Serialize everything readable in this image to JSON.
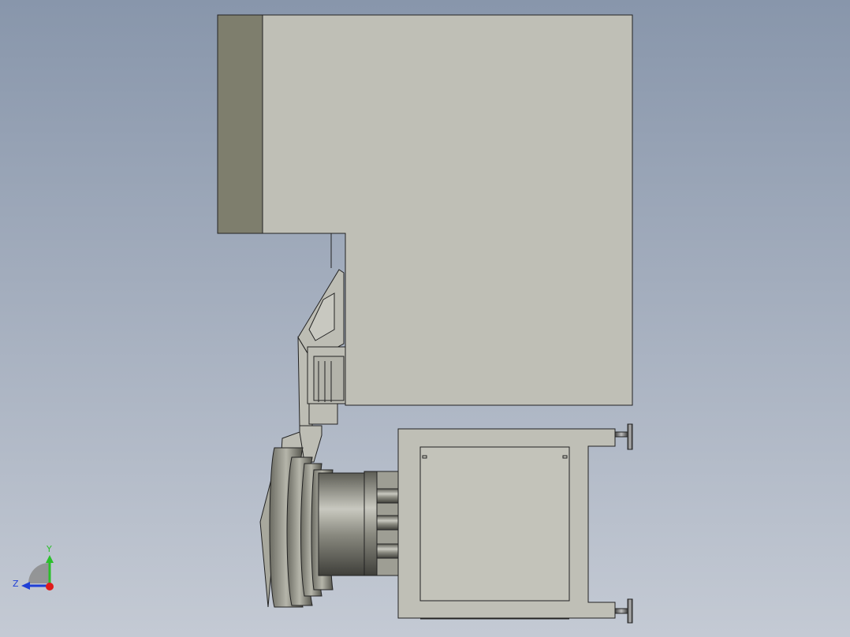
{
  "viewport": {
    "background_top": "#8896ab",
    "background_bottom": "#c4cad4"
  },
  "triad": {
    "y_label": "Y",
    "z_label": "Z",
    "y_color": "#2bbf2b",
    "z_color": "#1f3fd6",
    "x_color": "#e01b1b"
  },
  "model": {
    "body_color": "#bfbfb5",
    "dark_face_color": "#7f7f6e",
    "edge_color": "#222222",
    "icons": [
      "robot-arm-model",
      "machine-base",
      "rotary-joint",
      "adjustable-foot",
      "view-triad"
    ]
  }
}
